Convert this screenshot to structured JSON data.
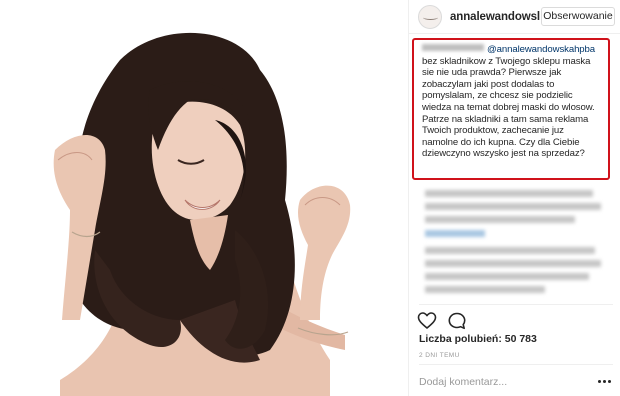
{
  "post": {
    "username": "annalewandowsl",
    "follow_label": "Obserwowanie",
    "comment": {
      "mention": "@annalewandowskahpba",
      "text": "bez skladnikow z Twojego sklepu maska sie nie uda prawda? Pierwsze jak zobaczylam jaki post dodalas to pomyslalam, ze chcesz sie podzielic wiedza na temat dobrej maski do wlosow. Patrze na skladniki a tam sama reklama Twoich produktow, zachecanie juz namolne do ich kupna. Czy dla Ciebie dziewczyno wszysko jest na sprzedaz?"
    },
    "likes_text": "Liczba polubień: 50 783",
    "time_text": "2 DNI TEMU",
    "add_comment_placeholder": "Dodaj komentarz..."
  },
  "icons": {
    "like": "heart-icon",
    "comment": "speech-bubble-icon",
    "more": "more-options-icon",
    "avatar": "profile-avatar"
  },
  "colors": {
    "highlight_border": "#d0121b",
    "mention": "#003569",
    "muted_text": "#999999",
    "text": "#262626"
  }
}
